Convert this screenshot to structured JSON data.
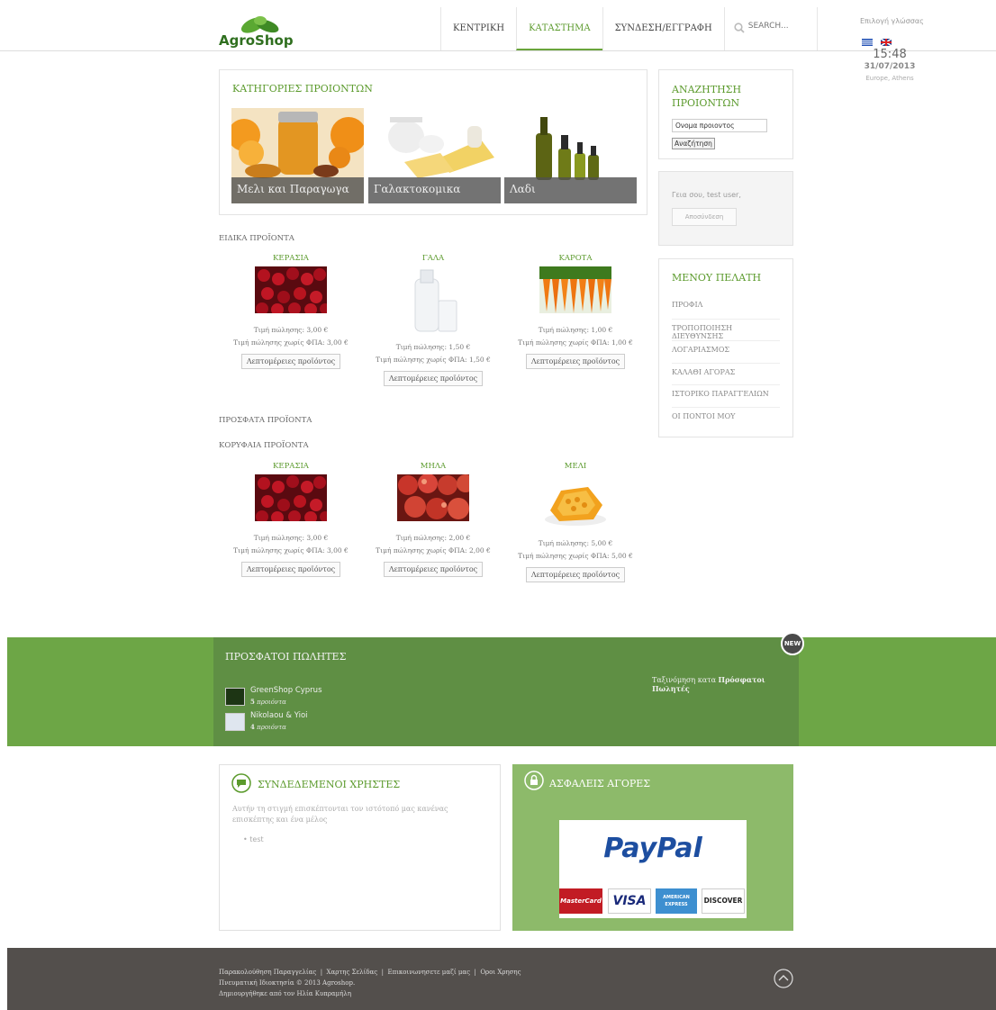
{
  "header": {
    "logo_text": "AgroShop",
    "nav": [
      "ΚΕΝΤΡΙΚΗ",
      "ΚΑΤΑΣΤΗΜΑ",
      "ΣΥΝΔΕΣΗ/ΕΓΓΡΑΦΗ"
    ],
    "search_placeholder": "SEARCH...",
    "language_label": "Επιλογή γλώσσας",
    "clock_time": "15:48",
    "clock_date": "31/07/2013",
    "clock_zone": "Europe, Athens"
  },
  "categories": {
    "title": "ΚΑΤΗΓΟΡΙΕΣ ΠΡΟΙΟΝΤΩΝ",
    "items": [
      "Μελι και Παραγωγα",
      "Γαλακτοκομικα",
      "Λαδι"
    ]
  },
  "product_search": {
    "title": "ΑΝΑΖΗΤΗΣΗ ΠΡΟΙΟΝΤΩΝ",
    "input_value": "Ονομα προιοντος",
    "button_label": "Αναζήτηση"
  },
  "user_box": {
    "greeting": "Γεια σου, test user,",
    "logout_label": "Αποσύνδεση"
  },
  "customer_menu": {
    "title": "ΜΕΝΟΥ ΠΕΛΑΤΗ",
    "items": [
      "ΠΡΟΦΙΛ",
      "ΤΡΟΠΟΠΟΙΗΣΗ ΔΙΕΥΘΥΝΣΗΣ",
      "ΛΟΓΑΡΙΑΣΜΟΣ",
      "ΚΑΛΑΘΙ ΑΓΟΡΑΣ",
      "ΙΣΤΟΡΙΚΟ ΠΑΡΑΓΓΕΛΙΩΝ",
      "ΟΙ ΠΟΝΤΟΙ ΜΟΥ"
    ]
  },
  "special_products": {
    "title": "ΕΙΔΙΚΑ ΠΡΟΪΟΝΤΑ",
    "items": [
      {
        "name": "ΚΕΡΑΣΙΑ",
        "price": "Τιμή πώλησης: 3,00 €",
        "price_no_vat": "Τιμή πώλησης χωρίς ΦΠΑ: 3,00 €",
        "button": "Λεπτομέρειες προϊόντος"
      },
      {
        "name": "ΓΑΛΑ",
        "price": "Τιμή πώλησης: 1,50 €",
        "price_no_vat": "Τιμή πώλησης χωρίς ΦΠΑ: 1,50 €",
        "button": "Λεπτομέρειες προϊόντος"
      },
      {
        "name": "ΚΑΡΟΤΑ",
        "price": "Τιμή πώλησης: 1,00 €",
        "price_no_vat": "Τιμή πώλησης χωρίς ΦΠΑ: 1,00 €",
        "button": "Λεπτομέρειες προϊόντος"
      }
    ]
  },
  "recent_products": {
    "title": "ΠΡΟΣΦΑΤΑ ΠΡΟΪΟΝΤΑ"
  },
  "top_products": {
    "title": "ΚΟΡΥΦΑΙΑ ΠΡΟΪΟΝΤΑ",
    "items": [
      {
        "name": "ΚΕΡΑΣΙΑ",
        "price": "Τιμή πώλησης: 3,00 €",
        "price_no_vat": "Τιμή πώλησης χωρίς ΦΠΑ: 3,00 €",
        "button": "Λεπτομέρειες προϊόντος"
      },
      {
        "name": "ΜΗΛΑ",
        "price": "Τιμή πώλησης: 2,00 €",
        "price_no_vat": "Τιμή πώλησης χωρίς ΦΠΑ: 2,00 €",
        "button": "Λεπτομέρειες προϊόντος"
      },
      {
        "name": "ΜΕΛΙ",
        "price": "Τιμή πώλησης: 5,00 €",
        "price_no_vat": "Τιμή πώλησης χωρίς ΦΠΑ: 5,00 €",
        "button": "Λεπτομέρειες προϊόντος"
      }
    ]
  },
  "recent_sellers": {
    "title": "ΠΡΟΣΦΑΤΟΙ ΠΩΛΗΤΕΣ",
    "badge": "NEW",
    "sort_prefix": "Ταξινόμηση κατα",
    "sort_value": "Πρόσφατοι Πωλητές",
    "sellers": [
      {
        "name": "GreenShop Cyprus",
        "count": "5",
        "count_label": "προιόντα"
      },
      {
        "name": "Nikolaou & Yioi",
        "count": "4",
        "count_label": "προιόντα"
      }
    ]
  },
  "online_users": {
    "title": "ΣΥΝΔΕΔΕΜΕΝΟΙ ΧΡΗΣΤΕΣ",
    "text": "Αυτήν τη στιγμή επισκέπτονται τον ιστότοπό μας κανένας επισκέπτης και ένα μέλος",
    "users": [
      "test"
    ]
  },
  "secure": {
    "title": "ΑΣΦΑΛΕΙΣ ΑΓΟΡΕΣ",
    "paypal": "PayPal",
    "cards": [
      "MasterCard",
      "VISA",
      "AMERICAN EXPRESS",
      "DISCOVER"
    ]
  },
  "footer": {
    "links": [
      "Παρακολούθηση Παραγγελίας",
      "Χαρτης Σελίδας",
      "Επικοινωνησετε μαζί μας",
      "Οροι Χρησης"
    ],
    "copyright": "Πνευματική Ιδιοκτησία © 2013 Agroshop.",
    "credit": "Δημιουργήθηκε από τον Ηλία Κυπραμήλη"
  }
}
